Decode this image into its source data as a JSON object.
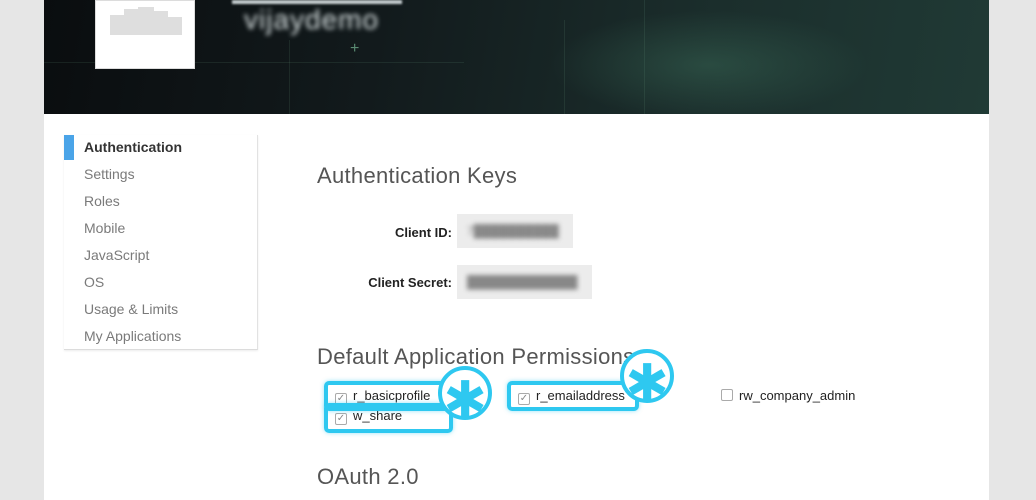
{
  "header": {
    "company_name": "vijaydemo"
  },
  "sidebar": {
    "items": [
      {
        "label": "Authentication",
        "active": true
      },
      {
        "label": "Settings"
      },
      {
        "label": "Roles"
      },
      {
        "label": "Mobile"
      },
      {
        "label": "JavaScript"
      },
      {
        "label": "OS"
      },
      {
        "label": "Usage & Limits"
      },
      {
        "label": "My Applications"
      }
    ]
  },
  "auth_keys": {
    "title": "Authentication Keys",
    "client_id_label": "Client ID:",
    "client_id_value": "7██████████",
    "client_secret_label": "Client Secret:",
    "client_secret_value": "█████████████"
  },
  "permissions": {
    "title": "Default Application Permissions",
    "items": [
      {
        "label": "r_basicprofile",
        "checked": true
      },
      {
        "label": "r_emailaddress",
        "checked": true
      },
      {
        "label": "rw_company_admin",
        "checked": false
      },
      {
        "label": "w_share",
        "checked": true
      }
    ],
    "highlight_color": "#2ec8f0",
    "badge_glyph": "✱"
  },
  "oauth": {
    "title": "OAuth 2.0"
  },
  "colors": {
    "accent": "#4aa4e8",
    "highlight": "#2ec8f0"
  }
}
